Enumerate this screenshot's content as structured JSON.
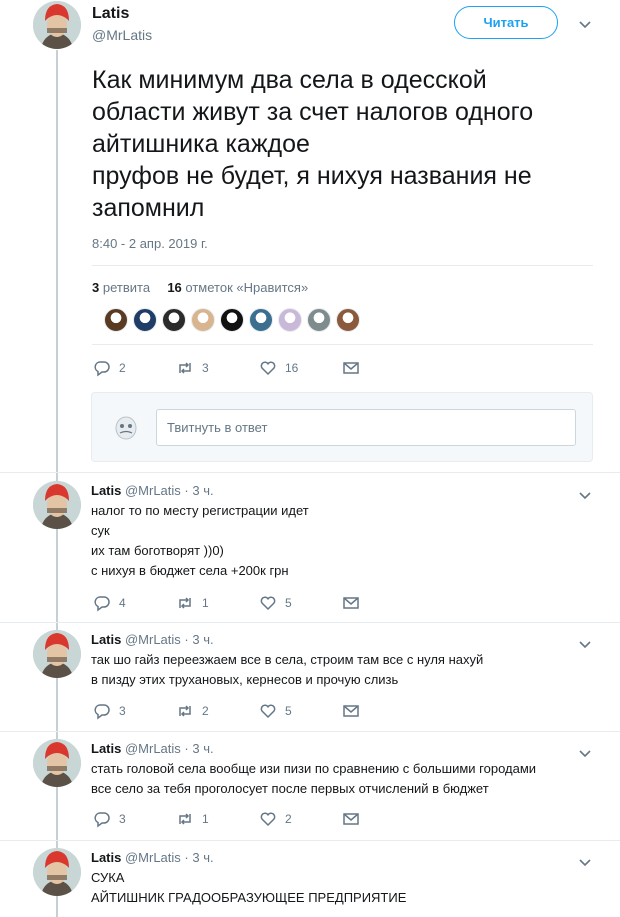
{
  "main_tweet": {
    "author_name": "Latis",
    "author_handle": "@MrLatis",
    "follow_label": "Читать",
    "text_lines": [
      "Как минимум два села в одесской",
      "области живут за счет налогов одного",
      "айтишника каждое",
      "пруфов не будет, я нихуя названия не",
      "запомнил"
    ],
    "timestamp": "8:40 - 2 апр. 2019 г.",
    "retweets_count": "3",
    "retweets_label": "ретвита",
    "likes_count": "16",
    "likes_label": "отметок «Нравится»",
    "actions": {
      "replies": "2",
      "retweets": "3",
      "likes": "16"
    },
    "reply_placeholder": "Твитнуть в ответ"
  },
  "replies": [
    {
      "author_name": "Latis",
      "author_handle": "@MrLatis",
      "time": "3 ч.",
      "lines": [
        "налог то по месту регистрации идет",
        "сук",
        "их там боготворят ))0)",
        "с нихуя в бюджет села +200к грн"
      ],
      "actions": {
        "replies": "4",
        "retweets": "1",
        "likes": "5"
      }
    },
    {
      "author_name": "Latis",
      "author_handle": "@MrLatis",
      "time": "3 ч.",
      "lines": [
        "так шо гайз переезжаем все в села, строим там все с нуля нахуй",
        "в пизду этих трухановых, кернесов и прочую слизь"
      ],
      "actions": {
        "replies": "3",
        "retweets": "2",
        "likes": "5"
      }
    },
    {
      "author_name": "Latis",
      "author_handle": "@MrLatis",
      "time": "3 ч.",
      "lines": [
        "стать головой села вообще изи пизи по сравнению с большими городами",
        "все село за тебя проголосует после первых отчислений в бюджет"
      ],
      "actions": {
        "replies": "3",
        "retweets": "1",
        "likes": "2"
      }
    },
    {
      "author_name": "Latis",
      "author_handle": "@MrLatis",
      "time": "3 ч.",
      "lines": [
        "СУКА",
        "АЙТИШНИК ГРАДООБРАЗУЮЩЕЕ ПРЕДПРИЯТИЕ"
      ]
    }
  ],
  "colors": {
    "accent": "#1da1f2",
    "muted_text": "#657786",
    "primary_text": "#14171a",
    "divider": "#e6ecf0",
    "thread_line": "#c4cfd6"
  },
  "liker_avatar_colors": [
    "#5a3b22",
    "#1f3d66",
    "#2b2b2b",
    "#d8b48f",
    "#111111",
    "#3c6e8f",
    "#c9b8d8",
    "#7f8c8d",
    "#8b5a3c"
  ]
}
